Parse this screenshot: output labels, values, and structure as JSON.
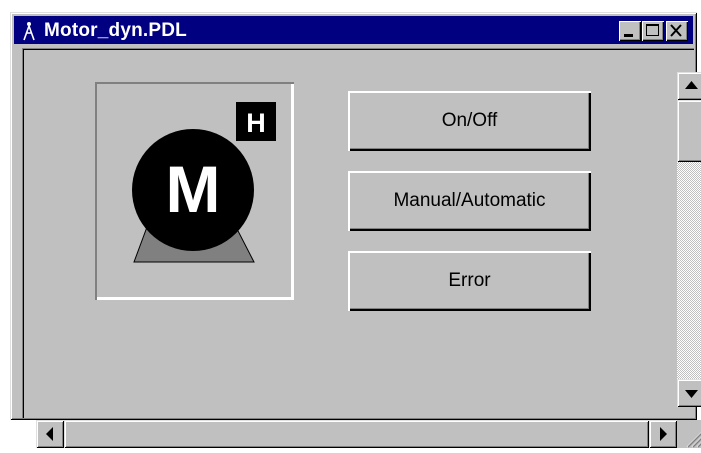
{
  "window": {
    "title": "Motor_dyn.PDL"
  },
  "title_buttons": [
    "minimize",
    "maximize",
    "close"
  ],
  "motor": {
    "letter": "M",
    "mode_letter": "H"
  },
  "buttons": [
    {
      "label": "On/Off"
    },
    {
      "label": "Manual/Automatic"
    },
    {
      "label": "Error"
    }
  ],
  "icons": {
    "app": "pdl-app-icon",
    "minimize": "minimize-icon",
    "maximize": "maximize-icon",
    "close": "close-icon",
    "scroll_up": "arrow-up-icon",
    "scroll_down": "arrow-down-icon",
    "scroll_left": "arrow-left-icon",
    "scroll_right": "arrow-right-icon",
    "size_grip": "size-grip-icon"
  },
  "colors": {
    "titlebar": "#000080",
    "face": "#c0c0c0",
    "motor_body": "#000000",
    "motor_base": "#808080"
  }
}
